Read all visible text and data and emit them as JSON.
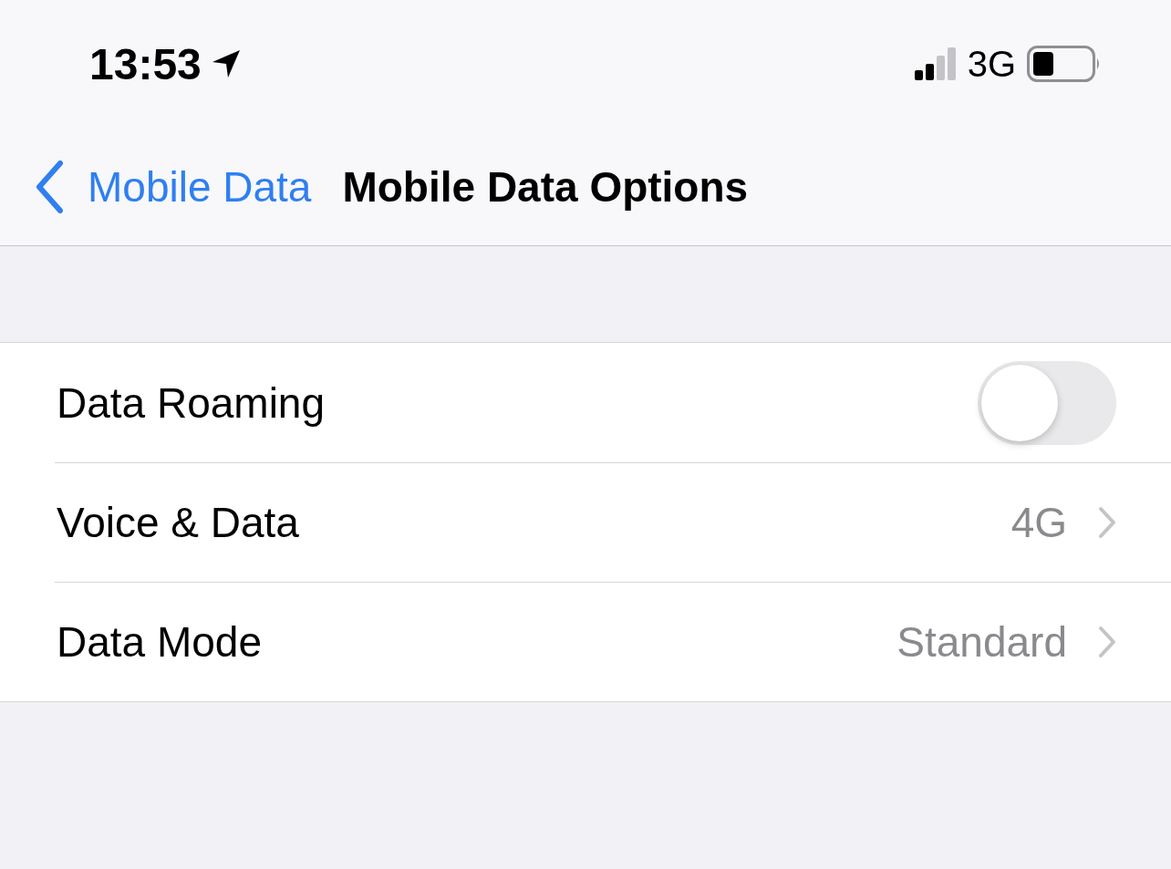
{
  "status_bar": {
    "time": "13:53",
    "network": "3G"
  },
  "nav": {
    "back": "Mobile Data",
    "title": "Mobile Data Options"
  },
  "rows": [
    {
      "kind": "toggle",
      "label": "Data Roaming",
      "on": false
    },
    {
      "kind": "link",
      "label": "Voice & Data",
      "value": "4G"
    },
    {
      "kind": "link",
      "label": "Data Mode",
      "value": "Standard"
    }
  ]
}
